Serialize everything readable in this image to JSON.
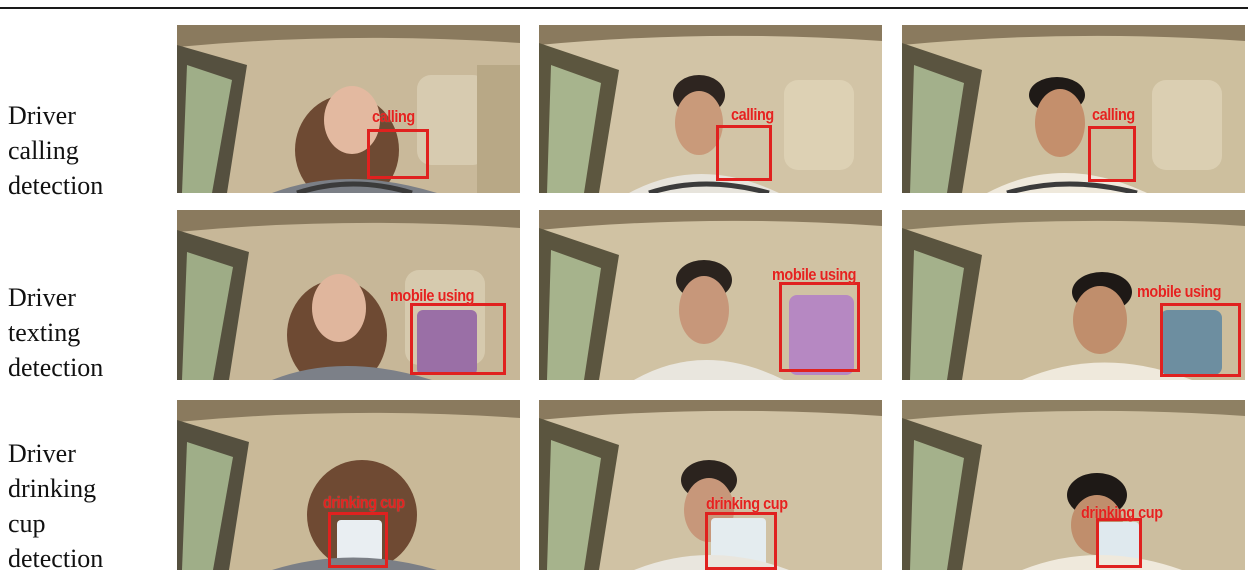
{
  "rows": [
    {
      "label": "Driver\ncalling\ndetection",
      "detection_label": "calling"
    },
    {
      "label": "Driver\ntexting\ndetection",
      "detection_label": "mobile using"
    },
    {
      "label": "Driver\ndrinking\ncup\ndetection",
      "detection_label": "drinking cup"
    }
  ],
  "colors": {
    "detection_box": "#e0211f",
    "label_text": "#111111"
  }
}
